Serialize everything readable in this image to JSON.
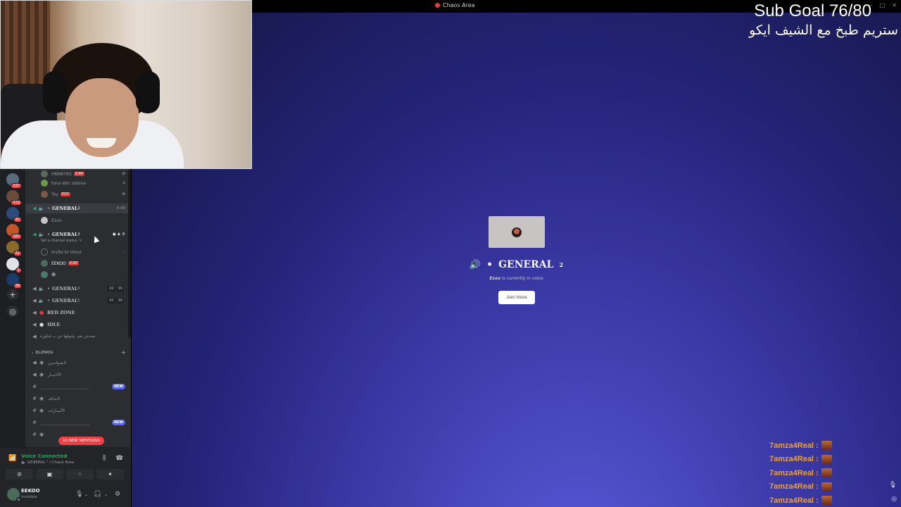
{
  "window": {
    "title": "Chaos Area"
  },
  "overlay": {
    "sub_goal": "Sub Goal 76/80",
    "stream_title": "ستريم طبخ مع الشيف ايكو"
  },
  "stage": {
    "channel_name": "GENERAL",
    "channel_sup": "2",
    "voice_user": "Esoo",
    "voice_text": "is currently in voice",
    "join_label": "Join Voice"
  },
  "rail": {
    "badges": [
      "227",
      "416",
      "32",
      "180",
      "41",
      "1",
      "36"
    ]
  },
  "channels": {
    "members_top": [
      {
        "name": "HNN6765",
        "tag": "ICRP"
      },
      {
        "name": "tona ebn zatona",
        "tag": ""
      },
      {
        "name": "Toy",
        "tag": "EGY"
      }
    ],
    "general2": {
      "name": "GENERAL",
      "sup": "2",
      "time": "4:46",
      "member": "Esoo"
    },
    "general3": {
      "name": "GENERAL",
      "sup": "3",
      "status": "Set a channel status",
      "invite": "Invite to Voice",
      "member": "EEKOO",
      "member_tag": "ICRP"
    },
    "general4": {
      "name": "GENERAL",
      "sup": "4",
      "counts": [
        "00",
        "99"
      ]
    },
    "general5": {
      "name": "GENERAL",
      "sup": "5",
      "counts": [
        "00",
        "99"
      ]
    },
    "red_zone": "RED ZONE",
    "idle": "IDLE",
    "arabic_row": "محدش بقى بشوفها عن ب فنكورة",
    "category": "ELZNOG",
    "text_channels": [
      {
        "name": "الـقـوانـيـن",
        "new": false
      },
      {
        "name": "الأخـبـار",
        "new": false
      },
      {
        "name": "_______________________",
        "new": true
      },
      {
        "name": "الـتـاف",
        "new": false
      },
      {
        "name": "الأسـارات",
        "new": false
      },
      {
        "name": "_______________________",
        "new": true
      }
    ],
    "new_label": "NEW",
    "mentions": "16 NEW MENTIONS"
  },
  "voice_panel": {
    "status": "Voice Connected",
    "location": "GENERAL ³ / Chaos Area"
  },
  "user_panel": {
    "name": "EEKOO",
    "status": "Invisible"
  },
  "chat": {
    "lines": [
      "7amza4Real :",
      "7amza4Real :",
      "7amza4Real :",
      "7amza4Real :",
      "7amza4Real :"
    ]
  },
  "colors": {
    "stage_center": "#5a59d8",
    "stage_edge": "#14143e",
    "discord_green": "#23a55a",
    "mention_red": "#f23f43",
    "new_blurple": "#5865f2",
    "chat_orange": "#f0a030"
  }
}
